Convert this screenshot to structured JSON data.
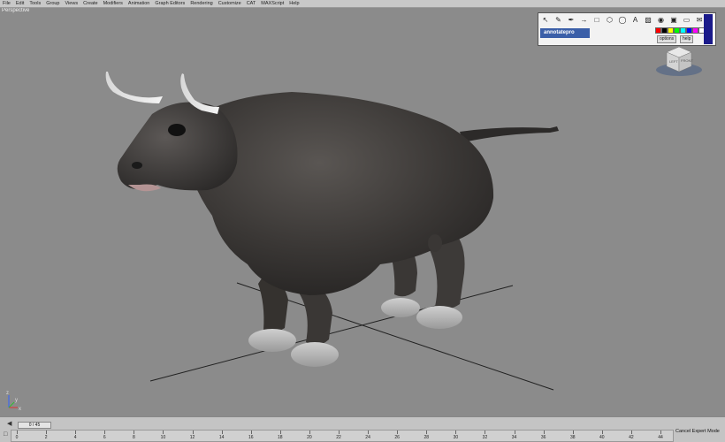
{
  "menu": [
    "File",
    "Edit",
    "Tools",
    "Group",
    "Views",
    "Create",
    "Modifiers",
    "Animation",
    "Graph Editors",
    "Rendering",
    "Customize",
    "CAT",
    "MAXScript",
    "Help"
  ],
  "viewport": {
    "label": "Perspective",
    "axis_labels": [
      "x",
      "y",
      "z"
    ]
  },
  "annotate": {
    "brand": "annotatepro",
    "options_label": "options",
    "help_label": "help",
    "tool_icons": [
      "pointer-icon",
      "pen-icon",
      "marker-icon",
      "arrow-icon",
      "rectangle-icon",
      "hexagon-icon",
      "oval-icon",
      "text-icon",
      "color-picker-icon",
      "stamp-icon",
      "camera-icon",
      "eraser-icon",
      "email-icon"
    ],
    "colors": [
      "#ff0000",
      "#000000",
      "#ffff00",
      "#00ff00",
      "#00ffff",
      "#0000ff",
      "#ff00ff",
      "#ffffff"
    ]
  },
  "viewcube": {
    "left_face": "LEFT",
    "front_face": "FRONT"
  },
  "timeline": {
    "frame_display": "0 / 45",
    "ticks": [
      "0",
      "2",
      "4",
      "6",
      "8",
      "10",
      "12",
      "14",
      "16",
      "18",
      "20",
      "22",
      "24",
      "26",
      "28",
      "30",
      "32",
      "34",
      "36",
      "38",
      "40",
      "42",
      "44"
    ],
    "cancel_label": "Cancel Expert Mode"
  }
}
